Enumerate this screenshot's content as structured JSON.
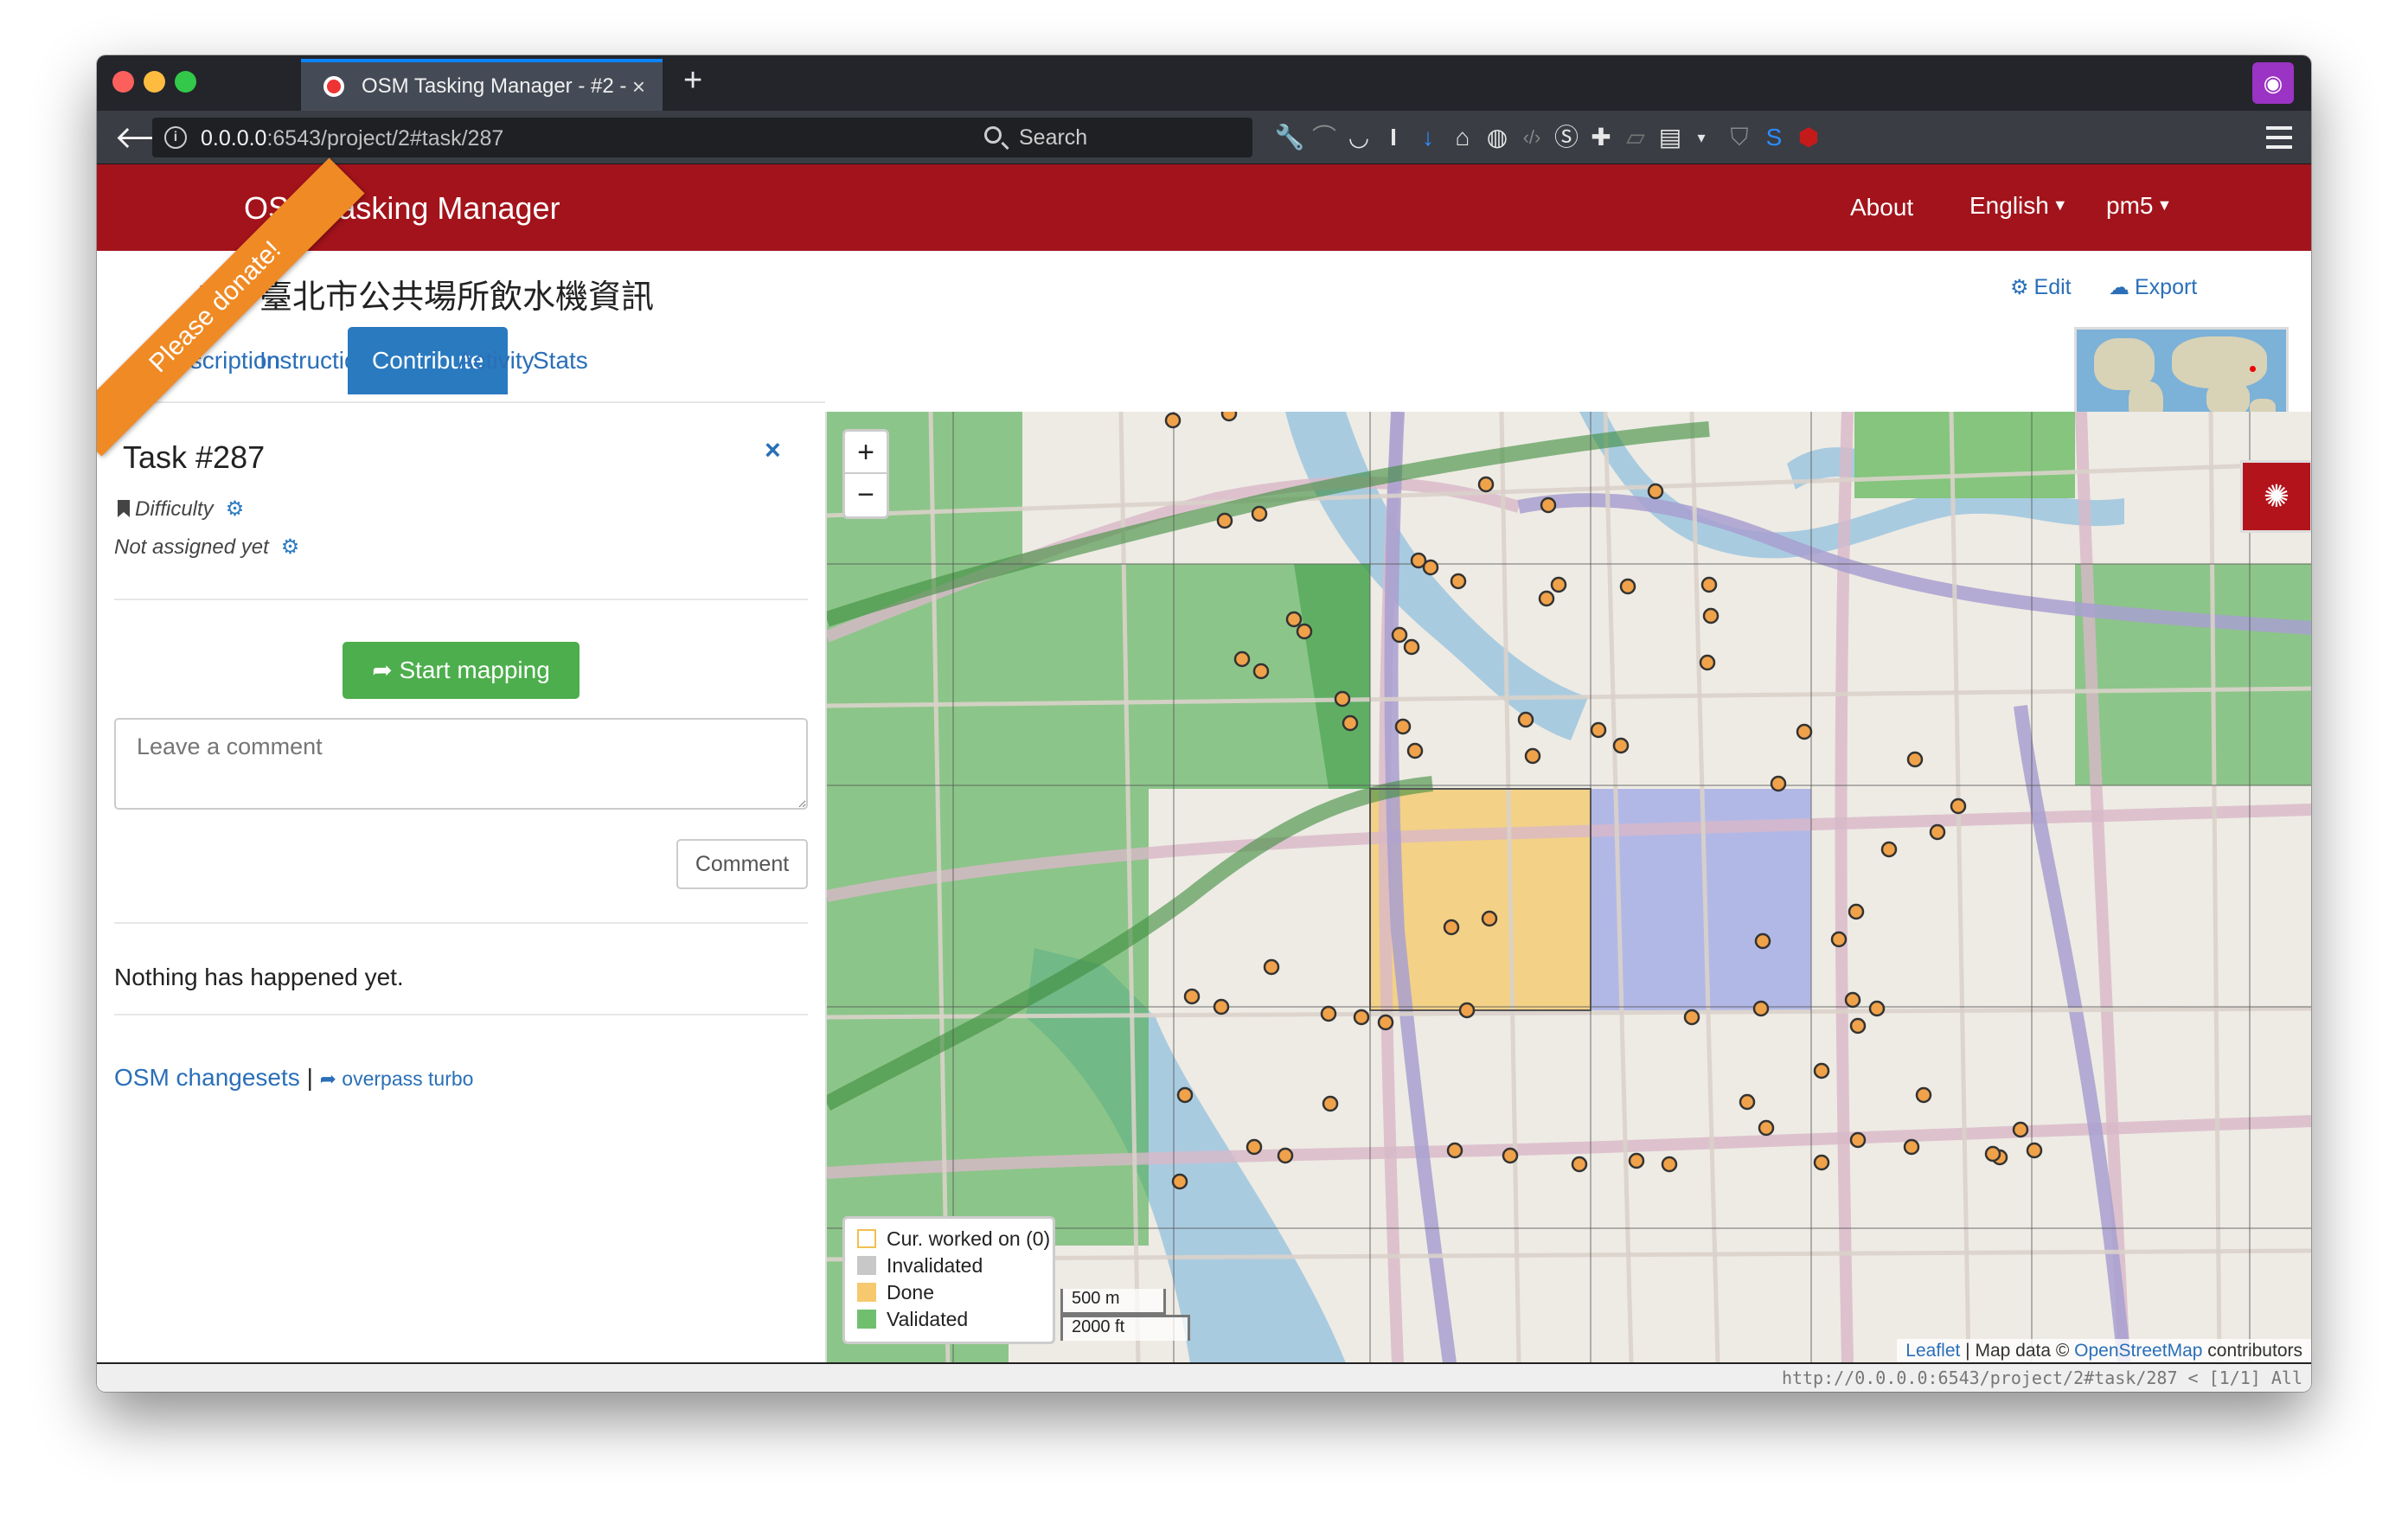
{
  "browser": {
    "tab_title": "OSM Tasking Manager - #2 -",
    "tab_close": "×",
    "new_tab": "+",
    "url_host": "0.0.0.0",
    "url_rest": ":6543/project/2#task/287",
    "search_placeholder": "Search",
    "status_url": "http://0.0.0.0:6543/project/2#task/287 < [1/1] All"
  },
  "header": {
    "brand": "OSM Tasking Manager",
    "about": "About",
    "language": "English",
    "user": "pm5",
    "ribbon": "Please donate!"
  },
  "project": {
    "title": "#2 - 臺北市公共場所飲水機資訊",
    "edit": "Edit",
    "export": "Export",
    "tabs": [
      {
        "label": "Description"
      },
      {
        "label": "Instructions"
      },
      {
        "label": "Contribute"
      },
      {
        "label": "Activity"
      },
      {
        "label": "Stats"
      }
    ]
  },
  "task": {
    "title": "Task #287",
    "close": "×",
    "difficulty": "Difficulty",
    "assignment": "Not assigned yet",
    "start_button": "Start mapping",
    "comment_placeholder": "Leave a comment",
    "comment_button": "Comment",
    "history": "Nothing has happened yet.",
    "changesets": "OSM changesets",
    "separator": "|",
    "overpass": "overpass turbo"
  },
  "map": {
    "zoom_in": "+",
    "zoom_out": "−",
    "legend": [
      {
        "label": "Cur. worked on (0)",
        "color": "#ffffff",
        "border": "#f0c050"
      },
      {
        "label": "Invalidated",
        "color": "#c8c8c8",
        "border": "#c8c8c8"
      },
      {
        "label": "Done",
        "color": "#f6c96e",
        "border": "#f6c96e"
      },
      {
        "label": "Validated",
        "color": "#6fbf6f",
        "border": "#6fbf6f"
      }
    ],
    "scale_metric": "500 m",
    "scale_imperial": "2000 ft",
    "attribution_leaflet": "Leaflet",
    "attribution_mid": " | Map data © ",
    "attribution_osm": "OpenStreetMap",
    "attribution_end": " contributors"
  },
  "icons": {
    "back": "back-arrow-icon",
    "gear": "gear-icon",
    "cloud": "cloud-download-icon",
    "share": "share-arrow-icon",
    "bookmark": "bookmark-icon",
    "cluster": "cluster-icon"
  },
  "colors": {
    "header_red": "#a3131b",
    "accent_blue": "#2a7ac0",
    "start_green": "#4cae4c",
    "ribbon_orange": "#f08a24"
  }
}
